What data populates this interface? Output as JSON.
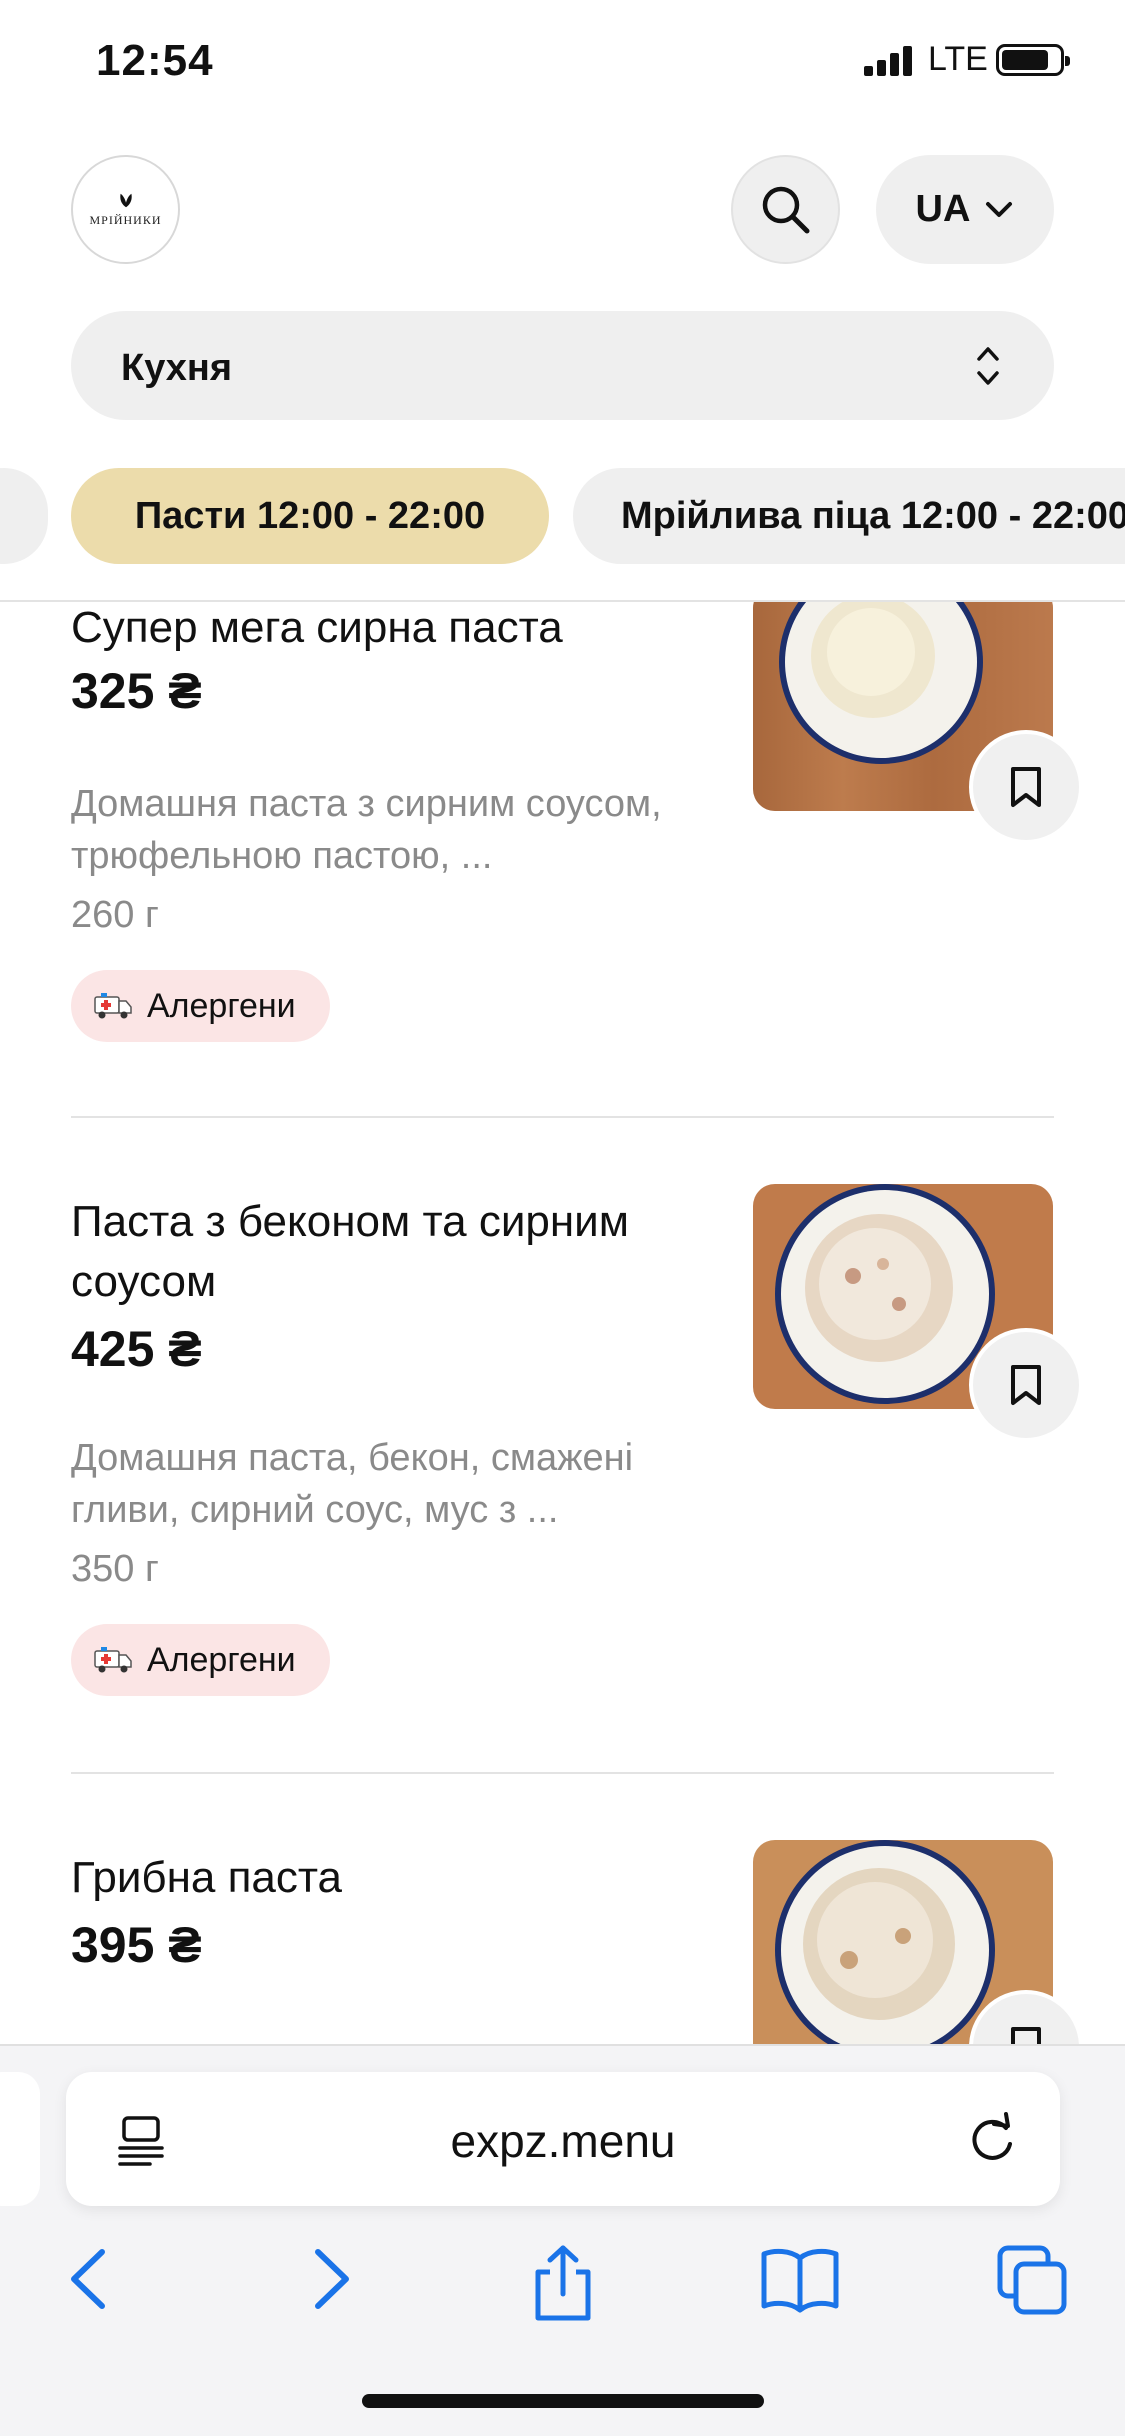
{
  "status": {
    "time": "12:54",
    "network": "LTE"
  },
  "header": {
    "logo_text": "МРІЙНИКИ",
    "language": "UA"
  },
  "category": {
    "selected": "Кухня"
  },
  "chips": [
    {
      "label": ""
    },
    {
      "label": "Пасти 12:00 - 22:00",
      "active": true
    },
    {
      "label": "Мрійлива піца 12:00 - 22:00"
    }
  ],
  "items": [
    {
      "name": "Супер мега сирна паста",
      "price": "325 ₴",
      "description": "Домашня паста з сирним соусом, трюфельною пастою, ...",
      "weight": "260 г",
      "allergen_label": "Алергени"
    },
    {
      "name": "Паста з беконом та сирним соусом",
      "price": "425 ₴",
      "description": "Домашня паста, бекон, смажені гливи, сирний соус, мус з ...",
      "weight": "350 г",
      "allergen_label": "Алергени"
    },
    {
      "name": "Грибна паста",
      "price": "395 ₴",
      "description": "",
      "weight": "",
      "allergen_label": ""
    }
  ],
  "browser": {
    "url": "expz.menu"
  },
  "colors": {
    "chip_active": "#ecdcab",
    "allergen_bg": "#fbe5e5",
    "ios_blue": "#1a73e8"
  }
}
